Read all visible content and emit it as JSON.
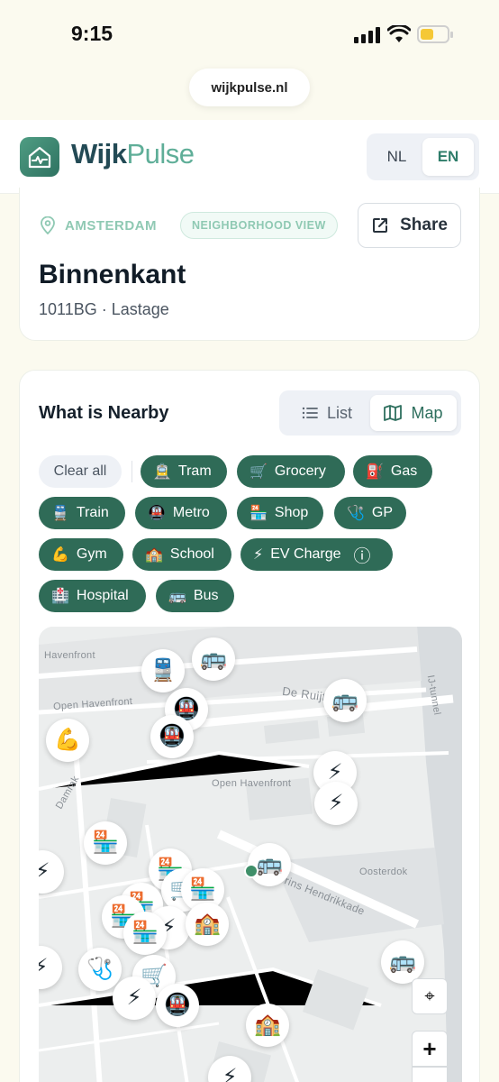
{
  "status": {
    "time": "9:15"
  },
  "browser": {
    "url": "wijkpulse.nl"
  },
  "brand": {
    "name_part1": "Wijk",
    "name_part2": "Pulse"
  },
  "language": {
    "options": [
      "NL",
      "EN"
    ],
    "selected": "EN"
  },
  "location": {
    "city": "AMSTERDAM",
    "view_badge": "NEIGHBORHOOD VIEW",
    "share_label": "Share",
    "title": "Binnenkant",
    "subtitle": "1011BG · Lastage"
  },
  "nearby": {
    "title": "What is Nearby",
    "view_options": {
      "list": "List",
      "map": "Map"
    },
    "selected_view": "Map",
    "clear_label": "Clear all",
    "chips": [
      {
        "emoji": "🚊",
        "label": "Tram"
      },
      {
        "emoji": "🛒",
        "label": "Grocery"
      },
      {
        "emoji": "⛽",
        "label": "Gas"
      },
      {
        "emoji": "🚆",
        "label": "Train"
      },
      {
        "emoji": "🚇",
        "label": "Metro"
      },
      {
        "emoji": "🏪",
        "label": "Shop"
      },
      {
        "emoji": "🩺",
        "label": "GP"
      },
      {
        "emoji": "💪",
        "label": "Gym"
      },
      {
        "emoji": "🏫",
        "label": "School"
      },
      {
        "emoji": "⚡",
        "label": "EV Charge",
        "info": "ⓘ"
      },
      {
        "emoji": "🏥",
        "label": "Hospital"
      },
      {
        "emoji": "🚌",
        "label": "Bus"
      }
    ]
  },
  "map": {
    "labels": {
      "havenfront": "Havenfront",
      "open_havenfront_1": "Open Havenfront",
      "open_havenfront_2": "Open Havenfront",
      "de_ruijterkade": "De Ruijterkade",
      "damrak": "Damrak",
      "prins_hendrikkade": "Prins Hendrikkade",
      "oosterdok": "Oosterdok",
      "ij_tunnel": "IJ-tunnel"
    },
    "controls": {
      "locate": "⌖",
      "zoom_in": "+",
      "zoom_out": "−"
    },
    "marker_icons": {
      "bus": "🚌",
      "train": "🚆",
      "metro": "🚇",
      "gym": "💪",
      "ev": "⚡",
      "shop": "🏪",
      "grocery": "🛒",
      "school": "🏫",
      "gp": "🩺"
    }
  }
}
